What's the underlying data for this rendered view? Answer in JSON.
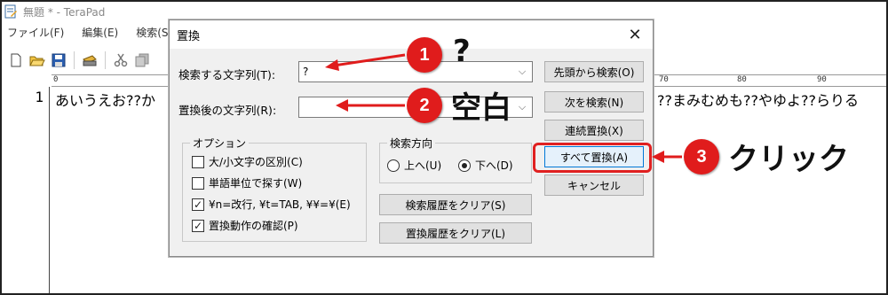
{
  "app": {
    "title": "無題 * - TeraPad",
    "menu": [
      "ファイル(F)",
      "編集(E)",
      "検索(S)"
    ],
    "ruler": {
      "mark_0": "0",
      "mark_70": "70",
      "mark_80": "80",
      "mark_90": "90"
    },
    "line_number": "1",
    "left_text": "あいうえお??か",
    "right_text": "??まみむめも??やゆよ??らりる"
  },
  "dialog": {
    "title": "置換",
    "find_label": "検索する文字列(T):",
    "find_value": "?",
    "replace_label": "置換後の文字列(R):",
    "replace_value": "",
    "options": {
      "title": "オプション",
      "case": {
        "label": "大/小文字の区別(C)",
        "checked": false
      },
      "word": {
        "label": "単語単位で探す(W)",
        "checked": false
      },
      "escape": {
        "label": "¥n=改行, ¥t=TAB, ¥¥=¥(E)",
        "checked": true
      },
      "confirm": {
        "label": "置換動作の確認(P)",
        "checked": true
      }
    },
    "direction": {
      "title": "検索方向",
      "up": "上へ(U)",
      "down": "下へ(D)",
      "selected": "down"
    },
    "buttons": {
      "search_from_top": "先頭から検索(O)",
      "search_next": "次を検索(N)",
      "continuous_replace": "連続置換(X)",
      "replace_all": "すべて置換(A)",
      "cancel": "キャンセル",
      "clear_search_history": "検索履歴をクリア(S)",
      "clear_replace_history": "置換履歴をクリア(L)"
    }
  },
  "annotations": {
    "step1": {
      "number": "1",
      "text": "?"
    },
    "step2": {
      "number": "2",
      "text": "空白"
    },
    "step3": {
      "number": "3",
      "text": "クリック"
    },
    "color": "#e01c1c"
  }
}
